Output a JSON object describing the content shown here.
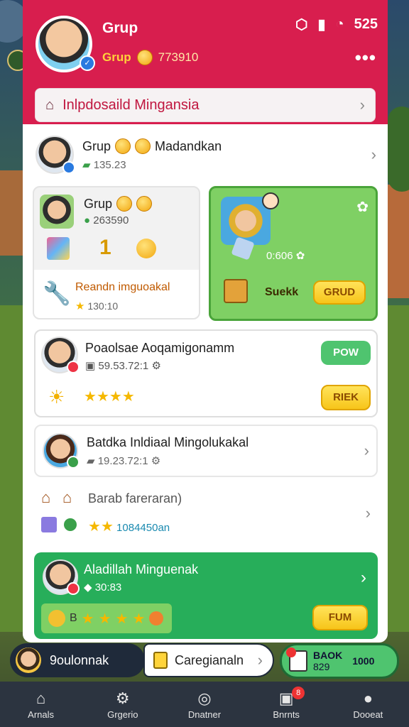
{
  "status_bar": {
    "time": "525"
  },
  "header": {
    "title": "Grup",
    "subtitle_label": "Grup",
    "subtitle_number": "773910",
    "more": "•••"
  },
  "banner": {
    "text": "Inlpdosaild Mingansia"
  },
  "friend_row": {
    "name": "Grup",
    "name2": "Madandkan",
    "score": "135.23"
  },
  "card_left": {
    "title": "Grup",
    "score": "263590",
    "center_value": "1",
    "reward_title": "Reandn imguoakal",
    "reward_value": "130:10"
  },
  "card_right": {
    "timer": "0:606",
    "label": "Suekk",
    "button": "GRUD"
  },
  "event_card": {
    "title": "Poaolsae Aoqamigonamm",
    "score": "59.53.72:1",
    "button_top": "POW",
    "button_bottom": "RIEK"
  },
  "row_batdka": {
    "title": "Batdka Inldiaal Mingolukakal",
    "score": "19.23.72:1"
  },
  "row_barab": {
    "title": "Barab fareraran)",
    "score": "1084450an"
  },
  "green_card": {
    "title": "Aladillah Minguenak",
    "score": "30:83",
    "prefix": "B",
    "button": "FUM"
  },
  "bottom_pills": {
    "left": "9oulonnak",
    "middle": "Caregianaln",
    "right_top": "BAOK",
    "right_bottom": "829",
    "right_extra": "1000"
  },
  "nav": {
    "items": [
      {
        "label": "Arnals",
        "icon": "home-icon"
      },
      {
        "label": "Grgerio",
        "icon": "gear-icon"
      },
      {
        "label": "Dnatner",
        "icon": "compass-icon"
      },
      {
        "label": "Bnrnts",
        "icon": "inbox-icon",
        "badge": "8"
      },
      {
        "label": "Dooeat",
        "icon": "profile-icon"
      }
    ]
  },
  "colors": {
    "header": "#d81e4e",
    "green": "#27ae5a",
    "yellow": "#f7c51a"
  }
}
